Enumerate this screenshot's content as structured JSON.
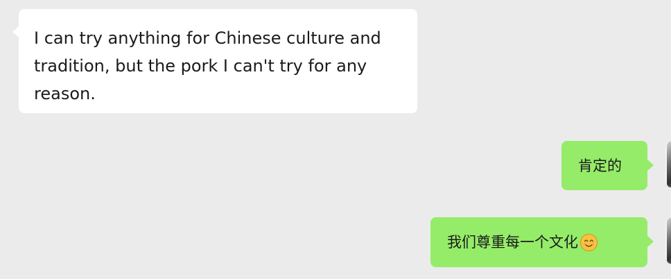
{
  "conversation": {
    "messages": [
      {
        "direction": "incoming",
        "text": "I can try anything for Chinese culture and tradition, but the pork I can't try for any reason."
      },
      {
        "direction": "outgoing",
        "text": "肯定的"
      },
      {
        "direction": "outgoing",
        "text": "我们尊重每一个文化",
        "emoji": "smiling-face-icon"
      }
    ]
  },
  "colors": {
    "background": "#ebebeb",
    "incoming_bubble": "#ffffff",
    "outgoing_bubble": "#95ec69",
    "text": "#1a1a1a"
  }
}
